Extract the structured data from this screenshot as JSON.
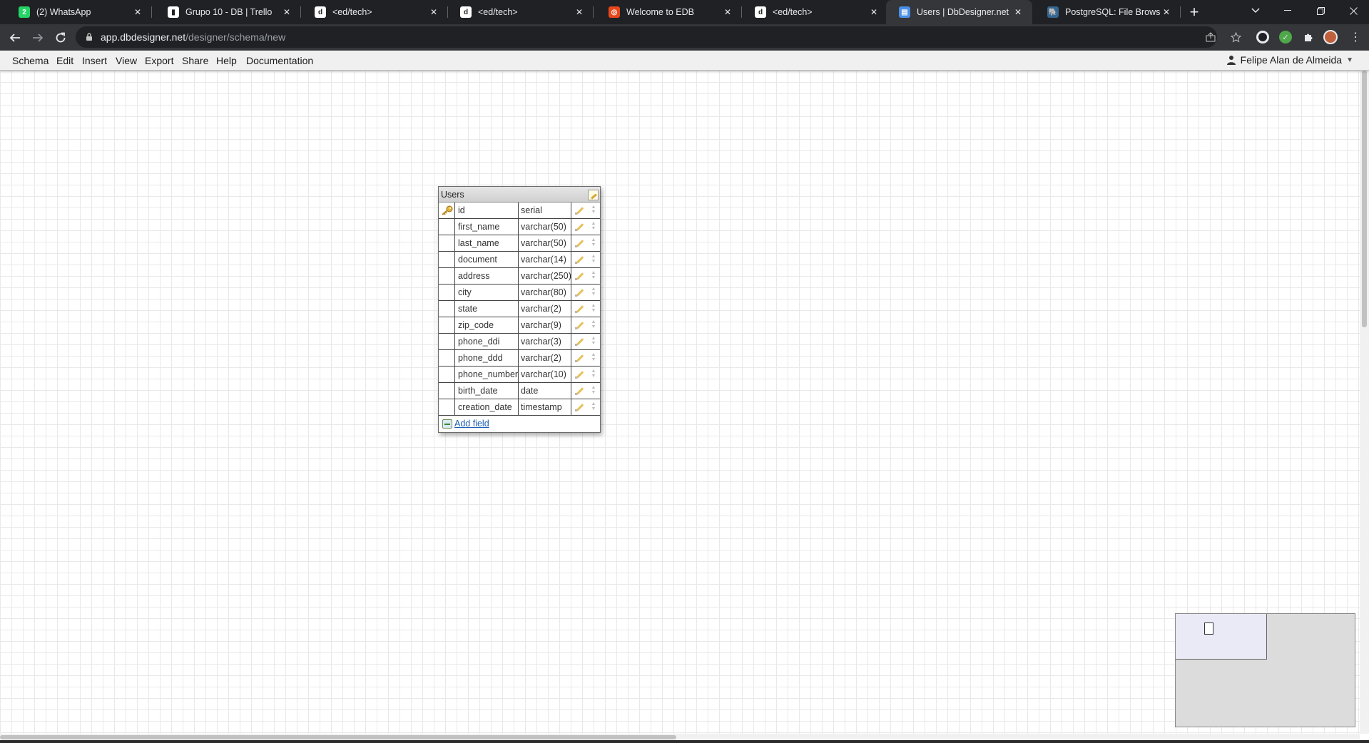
{
  "browser": {
    "tabs": [
      {
        "title": "(2) WhatsApp",
        "icon": "whatsapp-icon",
        "color": "#25d366",
        "glyph": "2"
      },
      {
        "title": "Grupo 10 - DB | Trello",
        "icon": "trello-icon",
        "color": "#ffffff",
        "glyph": "▮"
      },
      {
        "title": "<ed/tech>",
        "icon": "edtech-icon",
        "color": "#ffffff",
        "glyph": "d"
      },
      {
        "title": "<ed/tech>",
        "icon": "edtech-icon",
        "color": "#ffffff",
        "glyph": "d"
      },
      {
        "title": "Welcome to EDB",
        "icon": "edb-icon",
        "color": "#e8471b",
        "glyph": "◎"
      },
      {
        "title": "<ed/tech>",
        "icon": "edtech-icon",
        "color": "#ffffff",
        "glyph": "d"
      },
      {
        "title": "Users | DbDesigner.net",
        "icon": "dbdesigner-icon",
        "color": "#4a8fe7",
        "glyph": "▤",
        "active": true
      },
      {
        "title": "PostgreSQL: File Browser",
        "icon": "postgresql-icon",
        "color": "#336791",
        "glyph": "🐘"
      }
    ],
    "url_host": "app.dbdesigner.net",
    "url_path": "/designer/schema/new"
  },
  "menubar": {
    "items": [
      "Schema",
      "Edit",
      "Insert",
      "View",
      "Export",
      "Share",
      "Help",
      "Documentation"
    ],
    "user_name": "Felipe Alan de Almeida"
  },
  "table": {
    "name": "Users",
    "fields": [
      {
        "name": "id",
        "type": "serial",
        "primary_key": true
      },
      {
        "name": "first_name",
        "type": "varchar(50)"
      },
      {
        "name": "last_name",
        "type": "varchar(50)"
      },
      {
        "name": "document",
        "type": "varchar(14)"
      },
      {
        "name": "address",
        "type": "varchar(250)"
      },
      {
        "name": "city",
        "type": "varchar(80)"
      },
      {
        "name": "state",
        "type": "varchar(2)"
      },
      {
        "name": "zip_code",
        "type": "varchar(9)"
      },
      {
        "name": "phone_ddi",
        "type": "varchar(3)"
      },
      {
        "name": "phone_ddd",
        "type": "varchar(2)"
      },
      {
        "name": "phone_number",
        "type": "varchar(10)"
      },
      {
        "name": "birth_date",
        "type": "date"
      },
      {
        "name": "creation_date",
        "type": "timestamp"
      }
    ],
    "add_field_label": "Add field"
  }
}
